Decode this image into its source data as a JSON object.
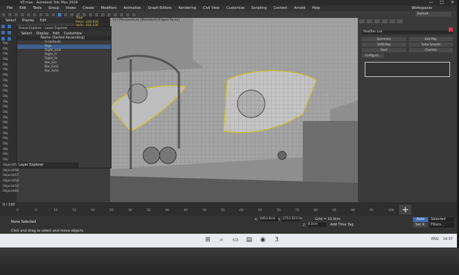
{
  "window": {
    "title": "KT.max - Autodesk 3ds Max 2024",
    "controls": [
      "—",
      "□",
      "✕"
    ]
  },
  "menu": {
    "items": [
      "File",
      "Edit",
      "Tools",
      "Group",
      "Views",
      "Create",
      "Modifiers",
      "Animation",
      "Graph Editors",
      "Rendering",
      "Civil View",
      "Customize",
      "Scripting",
      "Content",
      "Arnold",
      "Help"
    ],
    "login": "Workspaces"
  },
  "toolbar": {
    "workspace": "Default"
  },
  "selection_bar": {
    "items": [
      "Select",
      "Display",
      "Edit"
    ]
  },
  "stats": {
    "label": "Total",
    "polys": "Polys: 430,930",
    "verts": "Verts: 416,430"
  },
  "scene_explorer": {
    "title": "Scene Explorer - Layer Explorer",
    "menu": [
      "Select",
      "Display",
      "Edit",
      "Customize"
    ],
    "column_header": "Name (Sorted Ascending)",
    "rows": [
      "0 (default)",
      "Rigs",
      "Right_Grid",
      "Right_Fr",
      "Right_Rr",
      "Bar_Ext",
      "Bar_Ext2",
      "Bar_Ext3"
    ],
    "footer": "Layer Explorer"
  },
  "sidebar_objects": [
    "Obj",
    "Obj",
    "Obj",
    "Obj",
    "Obj",
    "Obj",
    "Obj",
    "Obj",
    "Obj",
    "Obj",
    "Obj",
    "Obj",
    "Obj",
    "Obj",
    "Obj",
    "Obj",
    "Obj",
    "Obj",
    "Obj",
    "Obj",
    "Obj",
    "Obj",
    "Obj",
    "Object055",
    "Object056",
    "Object057",
    "Object058",
    "Object059",
    "Object060"
  ],
  "viewport": {
    "label": "[+] [Perspective] [Standard] [Edged Faces]"
  },
  "command_panel": {
    "modifier_list": "Modifier List",
    "buttons": [
      "Symmetry",
      "Edit Poly",
      "UVW Map",
      "Turbo Smooth",
      "Shell",
      "Chamfer"
    ],
    "extra": "Configure..."
  },
  "timeline": {
    "frame": "0 / 100",
    "ticks": [
      "0",
      "5",
      "10",
      "15",
      "20",
      "25",
      "30",
      "35",
      "40",
      "45",
      "50",
      "55",
      "60",
      "65",
      "70",
      "75",
      "80",
      "85",
      "90",
      "95",
      "100"
    ]
  },
  "status": {
    "none_selected": "None Selected",
    "hint": "Click and drag to select and move objects",
    "x": "4453.8cm",
    "y": "1753.527cm",
    "z": "8.0cm",
    "grid": "Grid = 10.0cm",
    "add_time_tag": "Add Time Tag",
    "auto": "Auto",
    "set_k": "Set K.",
    "selected": "Selected",
    "filters": "Filters..."
  },
  "taskbar": {
    "tray": [
      "ENG",
      "14:37"
    ]
  }
}
